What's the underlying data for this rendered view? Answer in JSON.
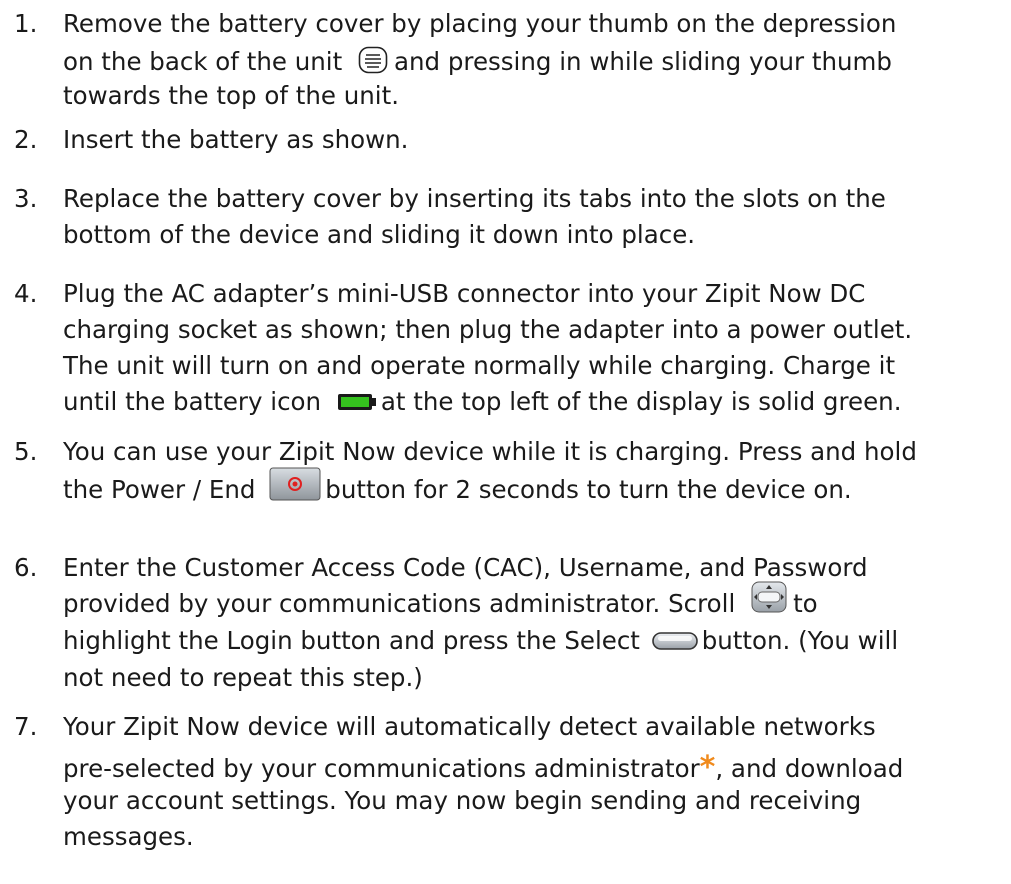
{
  "steps": [
    {
      "number": "1.",
      "lines": [
        "Remove the battery cover by placing your thumb on the depression",
        "on the back of the unit",
        "and pressing in while sliding your thumb",
        "towards the top of the unit."
      ]
    },
    {
      "number": "2.",
      "lines": [
        "Insert the battery as shown."
      ]
    },
    {
      "number": "3.",
      "lines": [
        "Replace the battery cover by inserting its tabs into the slots on the",
        "bottom of the device and sliding it down into place."
      ]
    },
    {
      "number": "4.",
      "lines": [
        "Plug the AC adapter’s mini-USB connector into your Zipit Now DC",
        "charging socket as shown; then plug the adapter into a power outlet.",
        "The unit will turn on and operate normally while charging.  Charge it",
        "until the battery icon",
        "at the top left of the display is solid green."
      ]
    },
    {
      "number": "5.",
      "lines": [
        "You can use your Zipit Now device while it is charging. Press and hold",
        "the Power / End",
        "button for 2 seconds to turn the device on."
      ]
    },
    {
      "number": "6.",
      "lines": [
        "Enter the Customer Access Code (CAC), Username, and Password",
        "provided by your communications administrator. Scroll",
        "to",
        "highlight the Login button and press the Select",
        "button.  (You will",
        "not need to repeat this step.)"
      ]
    },
    {
      "number": "7.",
      "lines": [
        "Your Zipit Now device will automatically detect available networks",
        "pre-selected by your communications administrator",
        "*",
        ", and download",
        "your account settings.  You may now begin sending and receiving",
        "messages."
      ]
    }
  ],
  "icons": {
    "thumb_depression": "thumb-depression-icon",
    "battery": "battery-icon",
    "power_end": "power-end-button-icon",
    "scroll": "scroll-key-icon",
    "select": "select-button-icon"
  },
  "colors": {
    "text": "#1a1a1a",
    "asterisk": "#f08a1c",
    "battery_fill": "#35c21e",
    "power_dot": "#e02020"
  }
}
